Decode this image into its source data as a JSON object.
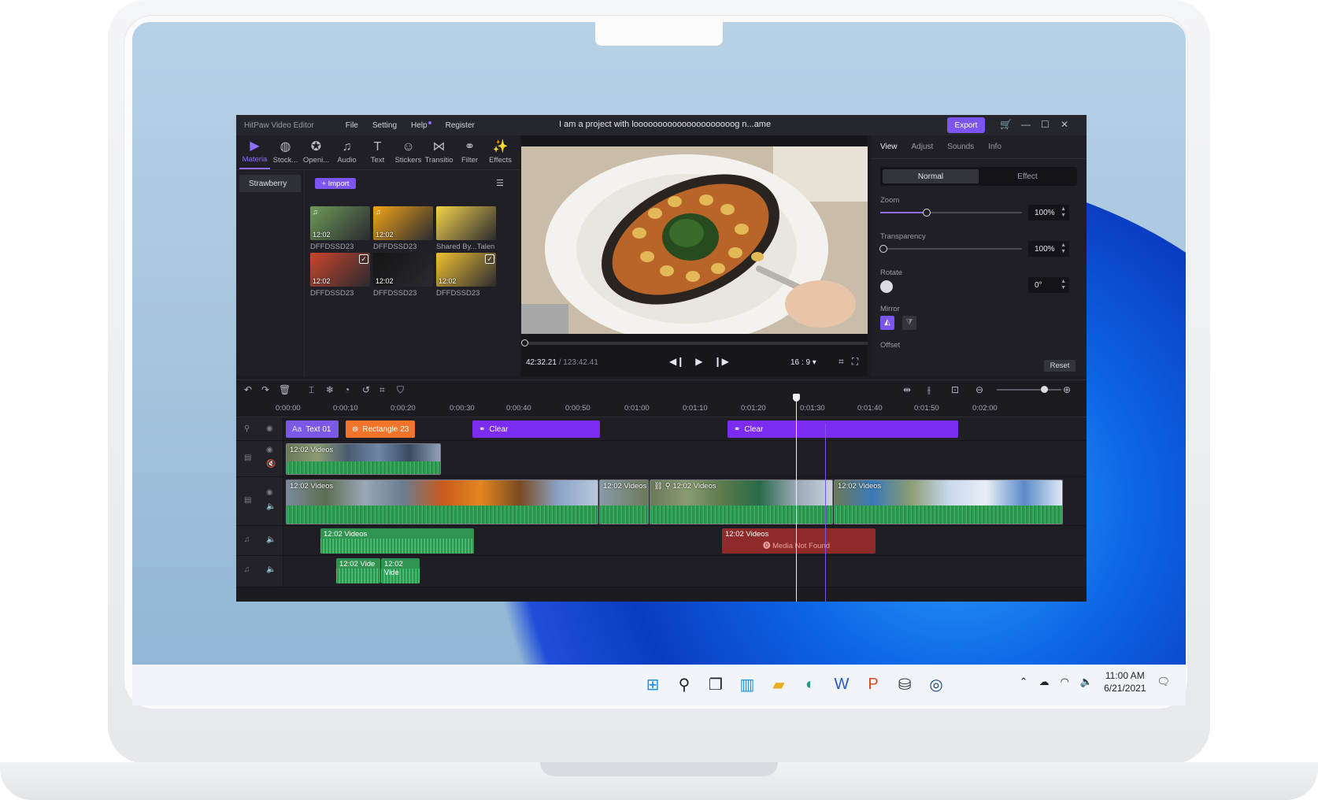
{
  "app": {
    "brand": "HitPaw Video Editor",
    "menu": [
      "File",
      "Setting",
      "Help",
      "Register"
    ],
    "project_title": "I am a project with looooooooooooooooooooog n...ame",
    "export_label": "Export"
  },
  "toolbar": {
    "tools": [
      {
        "label": "Materia",
        "icon": "media-icon",
        "glyph": "▶"
      },
      {
        "label": "Stock...",
        "icon": "globe-icon",
        "glyph": "◍"
      },
      {
        "label": "Openi...",
        "icon": "film-reel-icon",
        "glyph": "✪"
      },
      {
        "label": "Audio",
        "icon": "music-note-icon",
        "glyph": "♫"
      },
      {
        "label": "Text",
        "icon": "text-icon",
        "glyph": "T"
      },
      {
        "label": "Stickers",
        "icon": "smiley-icon",
        "glyph": "☺"
      },
      {
        "label": "Transitio",
        "icon": "transition-icon",
        "glyph": "⋈"
      },
      {
        "label": "Filter",
        "icon": "filter-icon",
        "glyph": "⚭"
      },
      {
        "label": "Effects",
        "icon": "magic-wand-icon",
        "glyph": "✨"
      }
    ]
  },
  "media": {
    "folder": "Strawberry",
    "import_label": "+ Import",
    "items": [
      {
        "name": "DFFDSSD23",
        "duration": "12:02",
        "color": "#6e9a58",
        "music": true,
        "checked": false
      },
      {
        "name": "DFFDSSD23",
        "duration": "12:02",
        "color": "#f2a417",
        "music": true,
        "checked": false
      },
      {
        "name": "Shared By...Talen",
        "duration": "",
        "color": "#f4d24a",
        "music": false,
        "checked": false
      },
      {
        "name": "DFFDSSD23",
        "duration": "12:02",
        "color": "#c9442c",
        "music": false,
        "checked": true
      },
      {
        "name": "DFFDSSD23",
        "duration": "12:02",
        "color": "#141414",
        "music": false,
        "checked": false
      },
      {
        "name": "DFFDSSD23",
        "duration": "12:02",
        "color": "#f0c030",
        "music": false,
        "checked": true
      }
    ]
  },
  "preview": {
    "time_current": "42:32.21",
    "time_total": " / 123:42.41",
    "ratio": "16 : 9 ▾"
  },
  "properties": {
    "tabs": [
      "View",
      "Adjust",
      "Sounds",
      "Info"
    ],
    "modes": [
      "Normal",
      "Effect"
    ],
    "zoom_label": "Zoom",
    "zoom_value": "100%",
    "zoom_level": 0.33,
    "transparency_label": "Transparency",
    "transparency_value": "100%",
    "transparency_level": 0.0,
    "rotate_label": "Rotate",
    "rotate_value": "0°",
    "mirror_label": "Mirror",
    "offset_label": "Offset",
    "reset_label": "Reset"
  },
  "timeline": {
    "ruler": [
      "0:00:00",
      "0:00:10",
      "0:00:20",
      "0:00:30",
      "0:00:40",
      "0:00:50",
      "0:01:00",
      "0:01:10",
      "0:01:20",
      "0:01:30",
      "0:01:40",
      "0:01:50",
      "0:02:00"
    ],
    "text_clips": [
      "Text 01",
      "Rectangle 23",
      "Clear",
      "Clear"
    ],
    "video_label": "12:02  Videos",
    "audio_label": "12:02  Videos",
    "audio_short_1": "12:02  Vide",
    "audio_short_2": "12:02  Vide",
    "missing": "Media Not Found"
  },
  "taskbar": {
    "time": "11:00 AM",
    "date": "6/21/2021"
  },
  "colors": {
    "accent": "#7c55f0",
    "clip_orange": "#f2742b",
    "clip_purple": "#7c2cf0",
    "audio_green": "#2f9450",
    "missing_red": "#8e2a2a"
  }
}
